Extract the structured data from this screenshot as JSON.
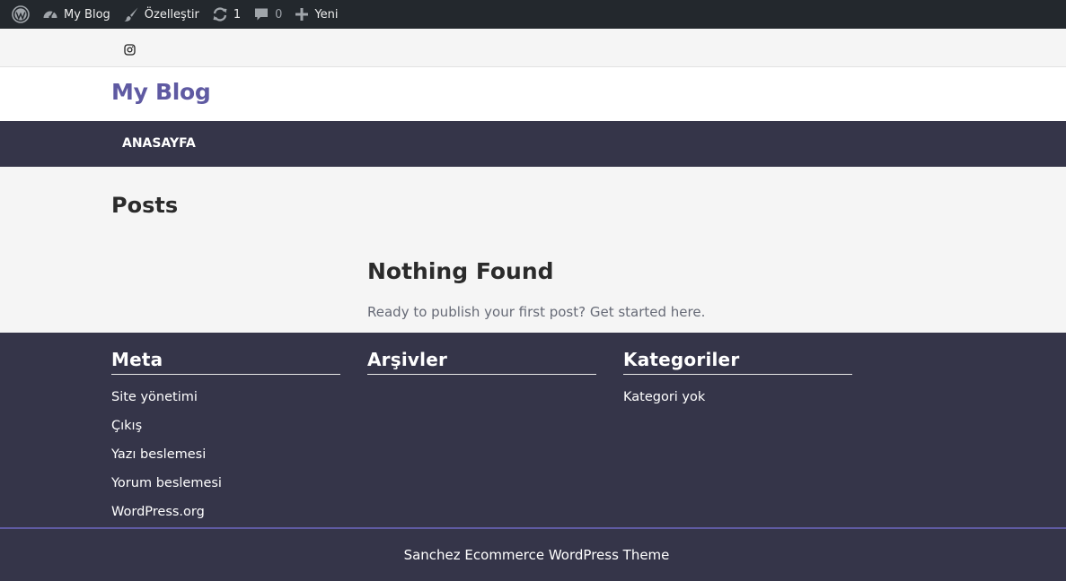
{
  "adminbar": {
    "items": [
      {
        "icon": "wordpress-logo-icon",
        "label": ""
      },
      {
        "icon": "dashboard-gauge-icon",
        "label": "My Blog"
      },
      {
        "icon": "paintbrush-icon",
        "label": "Özelleştir"
      },
      {
        "icon": "update-refresh-icon",
        "label": "1"
      },
      {
        "icon": "comment-bubble-icon",
        "label": "0"
      },
      {
        "icon": "plus-icon",
        "label": "Yeni"
      }
    ]
  },
  "topbar": {
    "social_icon": "instagram-icon"
  },
  "header": {
    "site_title": "My Blog",
    "accent_color": "#5f5aa2"
  },
  "nav": {
    "items": [
      "ANASAYFA"
    ],
    "background": "#353549"
  },
  "main": {
    "page_title": "Posts",
    "not_found_title": "Nothing Found",
    "not_found_text": "Ready to publish your first post? Get started here."
  },
  "footer": {
    "widgets": [
      {
        "title": "Meta",
        "items": [
          "Site yönetimi",
          "Çıkış",
          "Yazı beslemesi",
          "Yorum beslemesi",
          "WordPress.org"
        ]
      },
      {
        "title": "Arşivler",
        "items": []
      },
      {
        "title": "Kategoriler",
        "items": [
          "Kategori yok"
        ]
      }
    ],
    "credit": "Sanchez Ecommerce WordPress Theme"
  }
}
